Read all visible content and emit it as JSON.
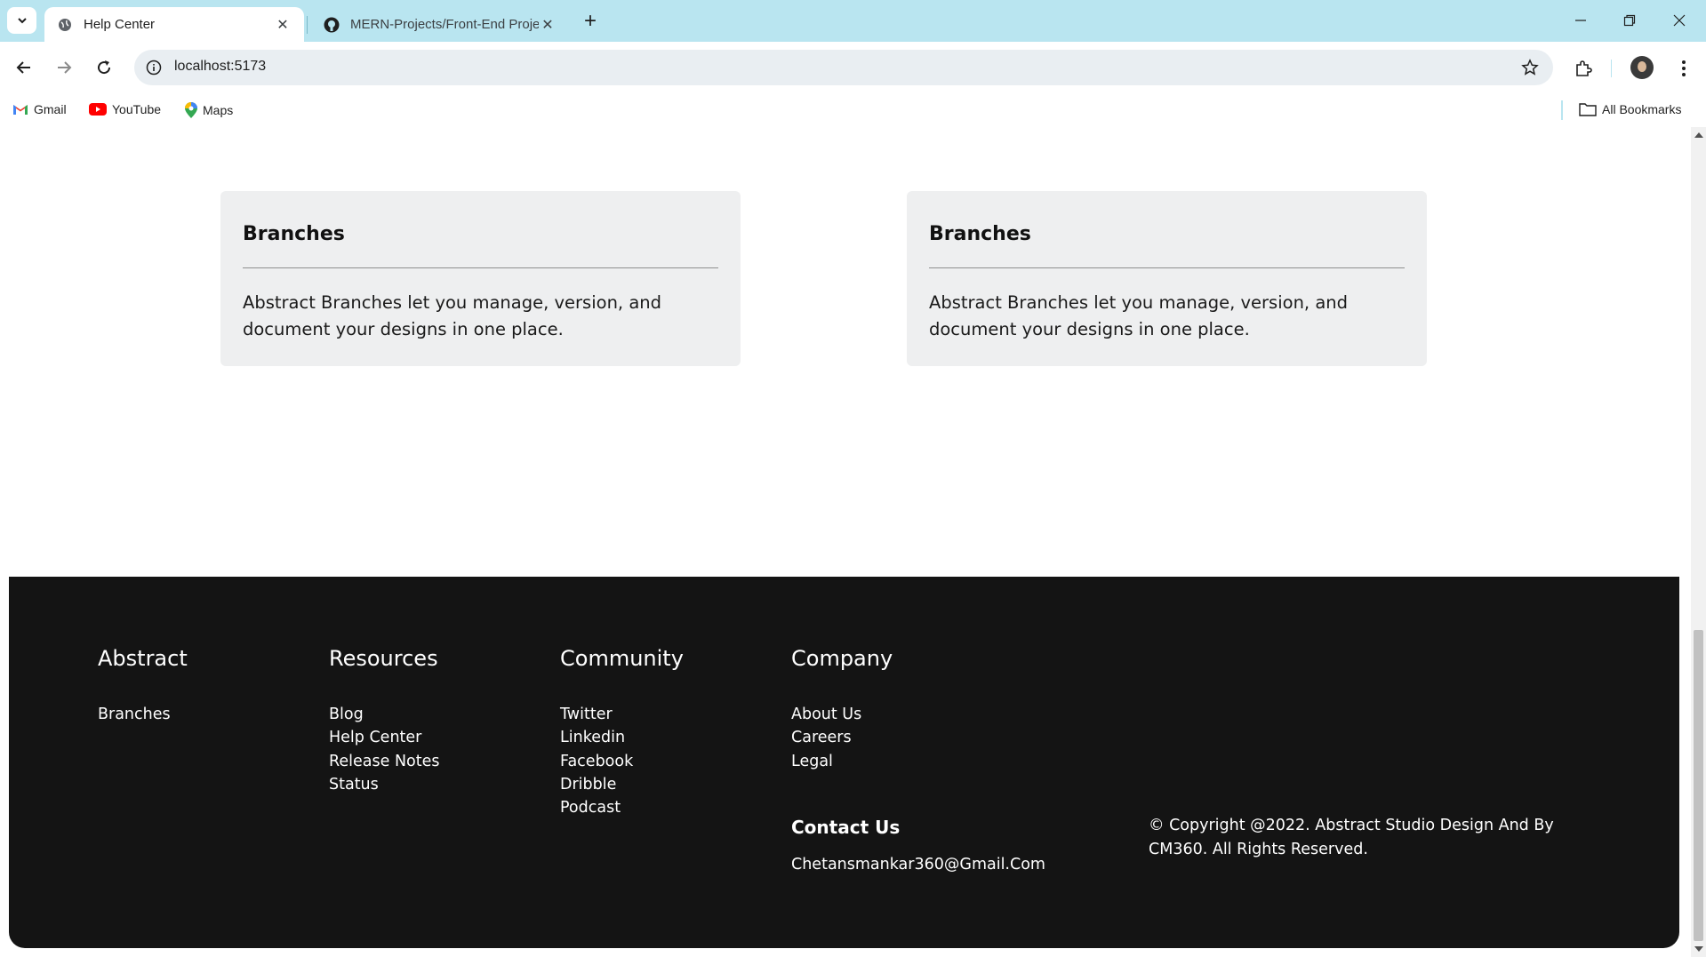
{
  "browser": {
    "tabs": [
      {
        "title": "Help Center",
        "active": true
      },
      {
        "title": "MERN-Projects/Front-End Proje",
        "active": false
      }
    ],
    "url": "localhost:5173",
    "bookmarks": [
      "Gmail",
      "YouTube",
      "Maps"
    ],
    "all_bookmarks": "All Bookmarks"
  },
  "cards": [
    {
      "title": "Branches",
      "text": "Abstract Branches let you manage, version, and document your designs in one place."
    },
    {
      "title": "Branches",
      "text": "Abstract Branches let you manage, version, and document your designs in one place."
    }
  ],
  "footer": {
    "columns": [
      {
        "heading": "Abstract",
        "links": [
          "Branches"
        ]
      },
      {
        "heading": "Resources",
        "links": [
          "Blog",
          "Help Center",
          "Release Notes",
          "Status"
        ]
      },
      {
        "heading": "Community",
        "links": [
          "Twitter",
          "Linkedin",
          "Facebook",
          "Dribble",
          "Podcast"
        ]
      },
      {
        "heading": "Company",
        "links": [
          "About Us",
          "Careers",
          "Legal"
        ]
      }
    ],
    "contact_heading": "Contact Us",
    "contact_email": "Chetansmankar360@Gmail.Com",
    "copyright": "© Copyright @2022. Abstract Studio Design And By CM360. All Rights Reserved."
  },
  "colors": {
    "tabbar": "#b9e5f0",
    "card_bg": "#eeeff0",
    "footer_bg": "#141414"
  }
}
